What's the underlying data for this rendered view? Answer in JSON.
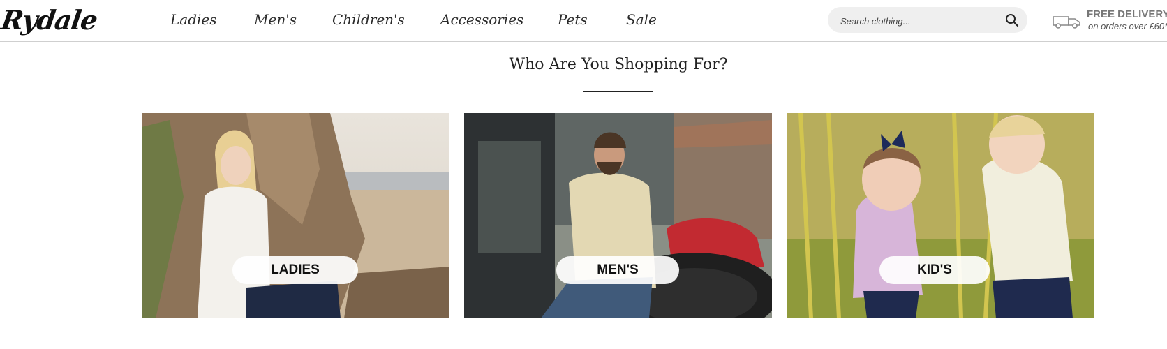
{
  "brand": {
    "logo_text": "Rydale"
  },
  "nav": {
    "items": [
      {
        "label": "Ladies"
      },
      {
        "label": "Men's"
      },
      {
        "label": "Children's"
      },
      {
        "label": "Accessories"
      },
      {
        "label": "Pets"
      },
      {
        "label": "Sale"
      }
    ]
  },
  "search": {
    "placeholder": "Search clothing...",
    "value": "",
    "icon": "search-icon"
  },
  "delivery": {
    "title": "FREE DELIVERY",
    "subtitle": "on orders over £60*",
    "icon": "van-icon"
  },
  "section": {
    "title": "Who Are You Shopping For?"
  },
  "cards": [
    {
      "label": "LADIES",
      "image": "ladies-photo"
    },
    {
      "label": "MEN'S",
      "image": "mens-photo"
    },
    {
      "label": "KID'S",
      "image": "kids-photo"
    }
  ],
  "colors": {
    "text": "#222222",
    "search_bg": "#efefef",
    "delivery_text": "#777777",
    "label_bg": "#ffffff"
  }
}
